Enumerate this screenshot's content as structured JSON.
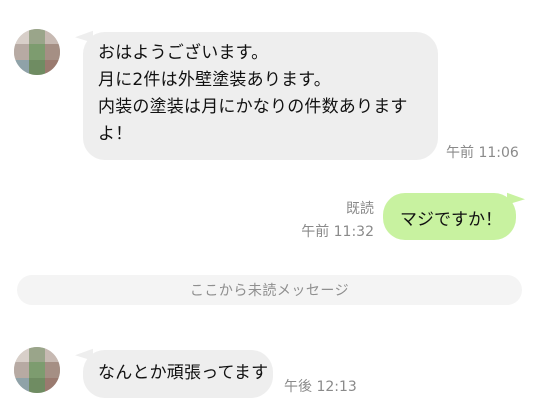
{
  "messages": [
    {
      "direction": "received",
      "lines": [
        "おはようございます。",
        "月に2件は外壁塗装あります。",
        "内装の塗装は月にかなりの件数ありま",
        "す",
        "よ！"
      ],
      "time": "午前 11:06"
    },
    {
      "direction": "sent",
      "text": "マジですか！",
      "read_label": "既読",
      "time": "午前 11:32"
    },
    {
      "direction": "received",
      "text": "なんとか頑張ってます",
      "time": "午後 12:13"
    }
  ],
  "unread_divider": "ここから未読メッセージ",
  "colors": {
    "received_bubble": "#eeeeee",
    "sent_bubble": "#c8f2a0",
    "timestamp": "#8a8a8a",
    "background": "#ffffff"
  }
}
